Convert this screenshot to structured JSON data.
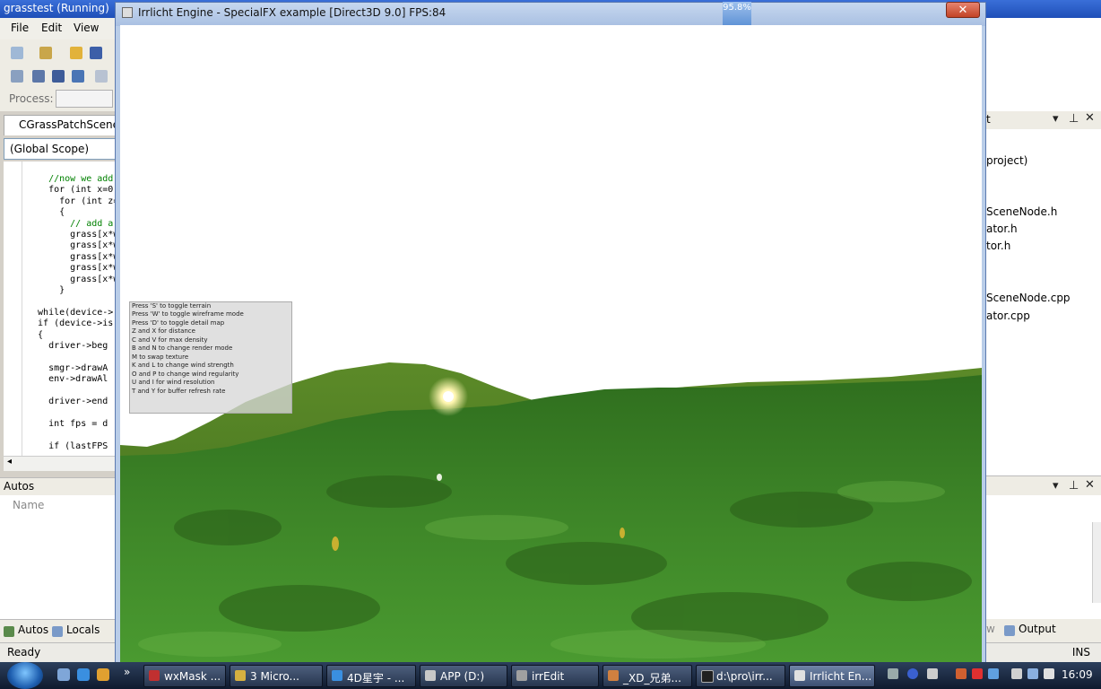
{
  "vs": {
    "title": "grasstest (Running)",
    "menu": [
      "File",
      "Edit",
      "View"
    ],
    "process_label": "Process:",
    "doc_tab": "CGrassPatchSceneN",
    "scope": "(Global Scope)",
    "code_lines": [
      "    //now we add",
      "    for (int x=0;",
      "      for (int z=",
      "      {",
      "        // add a",
      "        grass[x*w",
      "        grass[x*w",
      "        grass[x*w",
      "        grass[x*w",
      "        grass[x*w",
      "      }",
      "",
      "  while(device->",
      "  if (device->is",
      "  {",
      "    driver->beg",
      "",
      "    smgr->drawA",
      "    env->drawAl",
      "",
      "    driver->end",
      "",
      "    int fps = d",
      "",
      "    if (lastFPS"
    ],
    "autos_title": "Autos",
    "autos_column": "Name",
    "bottom_tabs": [
      "Autos",
      "Locals"
    ],
    "status": "Ready",
    "ins": "INS",
    "right_items": [
      "project)",
      "SceneNode.h",
      "ator.h",
      "tor.h",
      "SceneNode.cpp",
      "ator.cpp"
    ],
    "right_title_fragment": "t",
    "output_tab": "Output",
    "right_tab_fragment": "w"
  },
  "irr": {
    "title": "Irrlicht Engine - SpecialFX example [Direct3D 9.0] FPS:84",
    "close_glyph": "✕",
    "help_lines": [
      "Press 'S' to toggle terrain",
      "Press 'W' to toggle wireframe mode",
      "Press 'D' to toggle detail map",
      "Z and X for distance",
      "C and V for max density",
      "B and N to change render mode",
      "M to swap texture",
      "K and L to change wind strength",
      "O and P to change wind regularity",
      "U and I for wind resolution",
      "T and Y for buffer refresh rate"
    ]
  },
  "cpu_meter": "95.8%",
  "taskbar": {
    "items": [
      "wxMask ...",
      "3 Micro...",
      "4D星宇 - ...",
      "APP (D:)",
      "irrEdit",
      "_XD_兄弟...",
      "d:\\pro\\irr...",
      "Irrlicht En..."
    ],
    "clock": "16:09"
  },
  "colors": {
    "grass_dark": "#2f6b1f",
    "grass_mid": "#3f8a2a",
    "grass_light": "#5aa83a",
    "hill": "#4a7a22",
    "sky": "#ffffff"
  }
}
